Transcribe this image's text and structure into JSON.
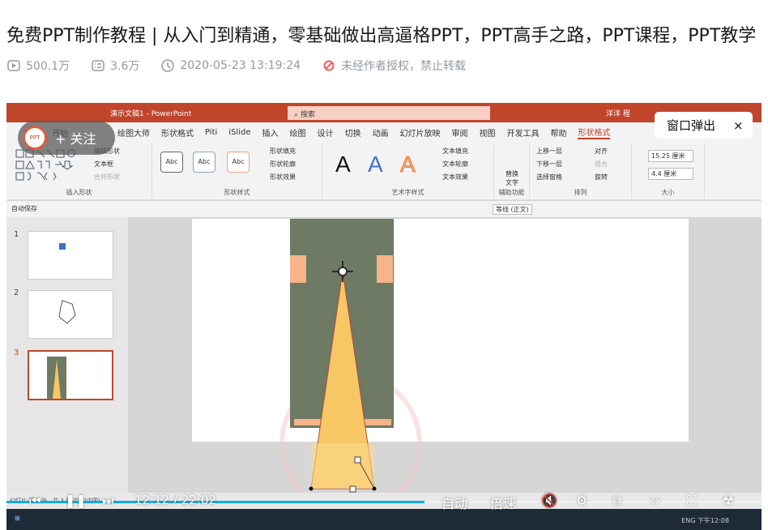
{
  "title": "免费PPT制作教程 | 从入门到精通，零基础做出高逼格PPT，PPT高手之路，PPT课程，PPT教学",
  "meta": {
    "views": "500.1万",
    "danmaku": "3.6万",
    "date": "2020-05-23 13:19:24",
    "copyright": "未经作者授权，禁止转载"
  },
  "ppt": {
    "doc_title": "演示文稿1 - PowerPoint",
    "search": "搜索",
    "user": "洋洋 程",
    "tabs": [
      "文件",
      "开始",
      "绘图大师",
      "形状格式",
      "Piti",
      "iSlide",
      "插入",
      "绘图",
      "设计",
      "切换",
      "动画",
      "幻灯片放映",
      "审阅",
      "视图",
      "开发工具",
      "帮助",
      "形状格式"
    ],
    "groups": {
      "insert_shape": "插入形状",
      "shape_style": "形状样式",
      "art_text": "艺术字样式",
      "accessibility": "辅助功能",
      "arrange": "排列",
      "size": "大小"
    },
    "cmds": {
      "edit_shape": "编辑形状",
      "textbox": "文本框",
      "merge": "合并形状",
      "fill": "形状填充",
      "outline": "形状轮廓",
      "effect": "形状效果",
      "text_fill": "文本填充",
      "text_outline": "文本轮廓",
      "text_effect": "文本效果",
      "alt_text": "替换文字",
      "forward": "上移一层",
      "backward": "下移一层",
      "selection": "选择窗格",
      "align": "对齐",
      "group": "组合",
      "rotate": "旋转",
      "height": "15.25 厘米",
      "width": "4.4 厘米",
      "abc": "Abc",
      "a": "A"
    },
    "autosave": "自动保存",
    "font": "等线 (正文)",
    "slides": [
      "1",
      "2",
      "3"
    ],
    "status": "幻灯片 第 3 张，共 3 张  中文(中国)",
    "tray": "ENG  下午12:08"
  },
  "player": {
    "follow": "+ 关注",
    "popout": "窗口弹出",
    "close": "×",
    "time": "12:12 / 22:02",
    "auto": "自动",
    "speed": "倍速",
    "progress": 0.554
  },
  "colors": {
    "accent": "#c0452b",
    "pants": "#6e7a63",
    "beam": "#f7c765"
  }
}
